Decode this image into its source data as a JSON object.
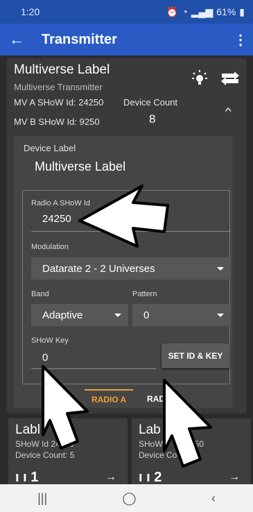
{
  "status_bar": {
    "time": "1:20",
    "battery": "61%"
  },
  "app_bar": {
    "title": "Transmitter"
  },
  "device": {
    "name": "Multiverse Label",
    "subtitle": "Multiverse Transmitter",
    "mv_a": "MV A SHoW Id: 24250",
    "mv_b": "MV B SHoW Id: 9250",
    "device_count_label": "Device Count",
    "device_count": "8"
  },
  "form": {
    "device_label_label": "Device Label",
    "device_label_value": "Multiverse Label",
    "radio_show_id_label": "Radio A SHoW Id",
    "radio_show_id_value": "24250",
    "modulation_label": "Modulation",
    "modulation_value": "Datarate 2 - 2 Universes",
    "band_label": "Band",
    "band_value": "Adaptive",
    "pattern_label": "Pattern",
    "pattern_value": "0",
    "show_key_label": "SHoW Key",
    "show_key_value": "0",
    "set_button": "SET ID & KEY"
  },
  "tabs": [
    {
      "label": "RADIO A",
      "active": true
    },
    {
      "label": "RADI",
      "active": false
    }
  ],
  "mini_cards": [
    {
      "title": "Labl",
      "show_id": "SHoW Id 24250",
      "count": "Device Count: 5",
      "number": "1"
    },
    {
      "title": "Lab",
      "show_id": "SHoW",
      "show_id_tail": "50",
      "count": "Device Co",
      "count_tail": "nt: 0",
      "number": "2"
    }
  ],
  "colors": {
    "app_bar": "#2a5bc4",
    "status_bar": "#1f4fa8",
    "accent": "#f0a030"
  },
  "icons": [
    "back-arrow-icon",
    "overflow-menu-icon",
    "lightbulb-icon",
    "rdm-icon",
    "chevron-up-icon",
    "dropdown-icon",
    "arrow-right-icon"
  ]
}
